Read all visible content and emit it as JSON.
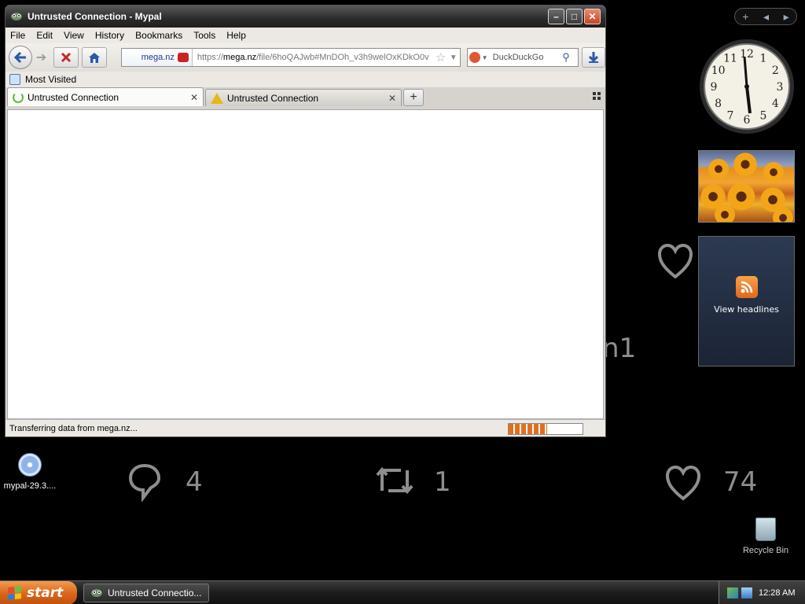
{
  "window": {
    "title": "Untrusted Connection - Mypal",
    "menu": [
      "File",
      "Edit",
      "View",
      "History",
      "Bookmarks",
      "Tools",
      "Help"
    ],
    "url_identity": "mega.nz",
    "url_prefix": "https://",
    "url_host": "mega.nz",
    "url_path": "/file/6hoQAJwb#MnDOh_v3h9welOxKDkO0v",
    "search_placeholder": "DuckDuckGo",
    "bookmarks": {
      "most_visited": "Most Visited"
    },
    "tabs": [
      {
        "label": "Untrusted Connection",
        "state": "loading"
      },
      {
        "label": "Untrusted Connection",
        "state": "warning"
      }
    ],
    "status_text": "Transferring data from mega.nz...",
    "progress": 0.52
  },
  "background": {
    "partial_count": "n1",
    "reply_count": "4",
    "retweet_count": "1",
    "like_count": "74"
  },
  "gadgets": {
    "clock_numbers": [
      "12",
      "1",
      "2",
      "3",
      "4",
      "5",
      "6",
      "7",
      "8",
      "9",
      "10",
      "11"
    ],
    "feed_label": "View headlines"
  },
  "desktop": {
    "icons": [
      {
        "label": "mypal-29.3...."
      },
      {
        "label": "Recycle Bin"
      }
    ]
  },
  "taskbar": {
    "start_label": "start",
    "task_label": "Untrusted Connectio...",
    "time": "12:28 AM"
  },
  "colors": {
    "loading_spinner": "#5dbb3d",
    "warning": "#e6b817",
    "progress_fill": "#e36f1e",
    "start_button": "#d9641b"
  }
}
